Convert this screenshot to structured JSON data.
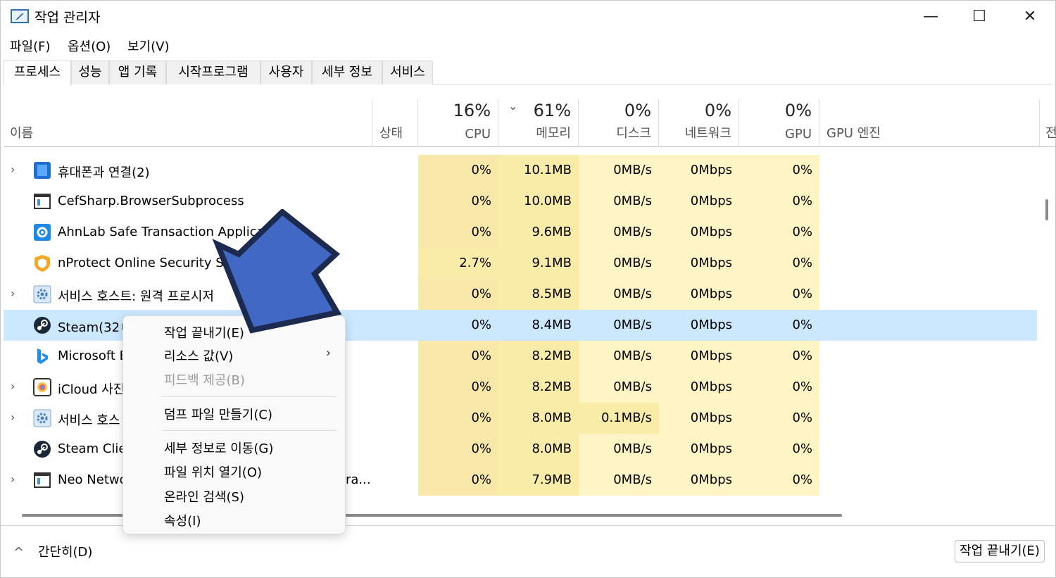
{
  "window": {
    "title": "작업 관리자",
    "minimize": "—",
    "maximize": "☐",
    "close": "✕"
  },
  "menu": [
    "파일(F)",
    "옵션(O)",
    "보기(V)"
  ],
  "tabs": [
    "프로세스",
    "성능",
    "앱 기록",
    "시작프로그램",
    "사용자",
    "세부 정보",
    "서비스"
  ],
  "header": {
    "name": "이름",
    "status": "상태",
    "cpu_pct": "16%",
    "cpu": "CPU",
    "mem_pct": "61%",
    "mem": "메모리",
    "disk_pct": "0%",
    "disk": "디스크",
    "net_pct": "0%",
    "net": "네트워크",
    "gpu_pct": "0%",
    "gpu": "GPU",
    "gpu_engine": "GPU 엔진",
    "power": "전"
  },
  "rows": [
    {
      "name": "휴대폰과 연결(2)",
      "expand": "›",
      "icon": "phone-link-icon",
      "cpu": "0%",
      "mem": "10.1MB",
      "disk": "0MB/s",
      "net": "0Mbps",
      "gpu": "0%"
    },
    {
      "name": "CefSharp.BrowserSubprocess",
      "expand": "",
      "icon": "window-app-icon",
      "cpu": "0%",
      "mem": "10.0MB",
      "disk": "0MB/s",
      "net": "0Mbps",
      "gpu": "0%"
    },
    {
      "name": "AhnLab Safe Transaction Applicatio",
      "expand": "",
      "icon": "gear-app-icon",
      "cpu": "0%",
      "mem": "9.6MB",
      "disk": "0MB/s",
      "net": "0Mbps",
      "gpu": "0%"
    },
    {
      "name": "nProtect Online Security Sta",
      "expand": "",
      "icon": "shield-icon",
      "cpu": "2.7%",
      "mem": "9.1MB",
      "disk": "0MB/s",
      "net": "0Mbps",
      "gpu": "0%"
    },
    {
      "name": "서비스 호스트: 원격 프로시저",
      "expand": "›",
      "icon": "service-gear-icon",
      "cpu": "0%",
      "mem": "8.5MB",
      "disk": "0MB/s",
      "net": "0Mbps",
      "gpu": "0%"
    },
    {
      "name": "Steam(32ㅂ",
      "expand": "",
      "icon": "steam-icon",
      "cpu": "0%",
      "mem": "8.4MB",
      "disk": "0MB/s",
      "net": "0Mbps",
      "gpu": "0%",
      "selected": true
    },
    {
      "name": "Microsoft E",
      "expand": "",
      "icon": "bing-icon",
      "cpu": "0%",
      "mem": "8.2MB",
      "disk": "0MB/s",
      "net": "0Mbps",
      "gpu": "0%"
    },
    {
      "name": "iCloud 사진",
      "expand": "›",
      "icon": "icloud-photos-icon",
      "cpu": "0%",
      "mem": "8.2MB",
      "disk": "0MB/s",
      "net": "0Mbps",
      "gpu": "0%"
    },
    {
      "name": "서비스 호스",
      "expand": "›",
      "icon": "service-gear-icon",
      "cpu": "0%",
      "mem": "8.0MB",
      "disk": "0.1MB/s",
      "net": "0Mbps",
      "gpu": "0%"
    },
    {
      "name": "Steam Clie",
      "expand": "",
      "icon": "steam-icon",
      "cpu": "0%",
      "mem": "8.0MB",
      "disk": "0MB/s",
      "net": "0Mbps",
      "gpu": "0%"
    },
    {
      "name": "Neo Netwo",
      "expand": "›",
      "icon": "window-app-icon",
      "cpu": "0%",
      "mem": "7.9MB",
      "disk": "0MB/s",
      "net": "0Mbps",
      "gpu": "0%",
      "status": "ra..."
    }
  ],
  "context_menu": {
    "end_task": "작업 끝내기(E)",
    "resource_values": "리소스 값(V)",
    "submenu_arrow": "›",
    "feedback": "피드백 제공(B)",
    "dump": "덤프 파일 만들기(C)",
    "goto_details": "세부 정보로 이동(G)",
    "open_location": "파일 위치 열기(O)",
    "search_online": "온라인 검색(S)",
    "properties": "속성(I)"
  },
  "footer": {
    "collapse_icon": "^",
    "collapse": "간단히(D)",
    "end_task": "작업 끝내기(E)"
  },
  "overlay": {
    "arrow_color": "#4169c4",
    "arrow_outline": "#1b2a4e"
  }
}
